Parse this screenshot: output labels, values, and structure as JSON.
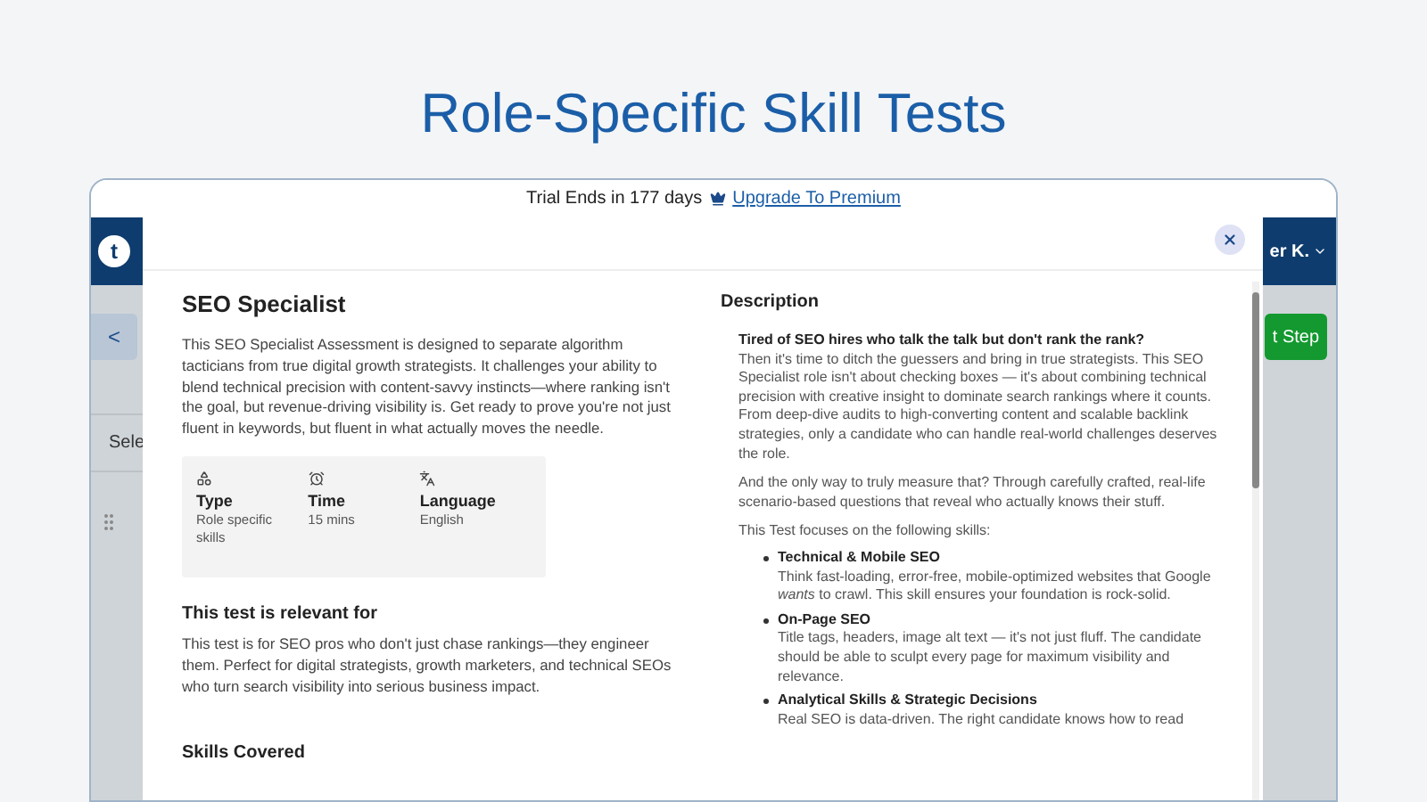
{
  "page_title": "Role-Specific Skill Tests",
  "trial_bar": {
    "text": "Trial Ends in 177 days",
    "link": "Upgrade To Premium"
  },
  "app": {
    "logo_letter": "t",
    "user": "er K.",
    "back": "<",
    "select_label": "Sele",
    "next_button": "t Step"
  },
  "modal": {
    "title": "SEO Specialist",
    "intro": "This SEO Specialist Assessment is designed to separate algorithm tacticians from true digital growth strategists. It challenges your ability to blend technical precision with content-savvy instincts—where ranking isn't the goal, but revenue-driving visibility is. Get ready to prove you're not just fluent in keywords, but fluent in what actually moves the needle.",
    "facts": [
      {
        "kind": "type",
        "label": "Type",
        "value": "Role specific skills"
      },
      {
        "kind": "time",
        "label": "Time",
        "value": "15 mins"
      },
      {
        "kind": "language",
        "label": "Language",
        "value": "English"
      }
    ],
    "relevant_heading": "This test is relevant for",
    "relevant_text": "This test is for SEO pros who don't just chase rankings—they engineer them. Perfect for digital strategists, growth marketers, and technical SEOs who turn search visibility into serious business impact.",
    "skills_heading": "Skills Covered",
    "description_heading": "Description",
    "description_lead": "Tired of SEO hires who talk the talk but don't rank the rank?",
    "description_paragraphs": [
      "Then it's time to ditch the guessers and bring in true strategists. This SEO Specialist role isn't about checking boxes — it's about combining technical precision with creative insight to dominate search rankings where it counts. From deep-dive audits to high-converting content and scalable backlink strategies, only a candidate who can handle real-world challenges deserves the role.",
      "And the only way to truly measure that? Through carefully crafted, real-life scenario-based questions that reveal who actually knows their stuff.",
      "This Test focuses on the following skills:"
    ],
    "skills": [
      {
        "name": "Technical & Mobile SEO",
        "text": "Think fast-loading, error-free, mobile-optimized websites that Google *wants* to crawl. This skill ensures your foundation is rock-solid."
      },
      {
        "name": "On-Page SEO",
        "text": "Title tags, headers, image alt text — it's not just fluff. The candidate should be able to sculpt every page for maximum visibility and relevance."
      },
      {
        "name": "Analytical Skills & Strategic Decisions",
        "text": "Real SEO is data-driven. The right candidate knows how to read"
      }
    ]
  }
}
